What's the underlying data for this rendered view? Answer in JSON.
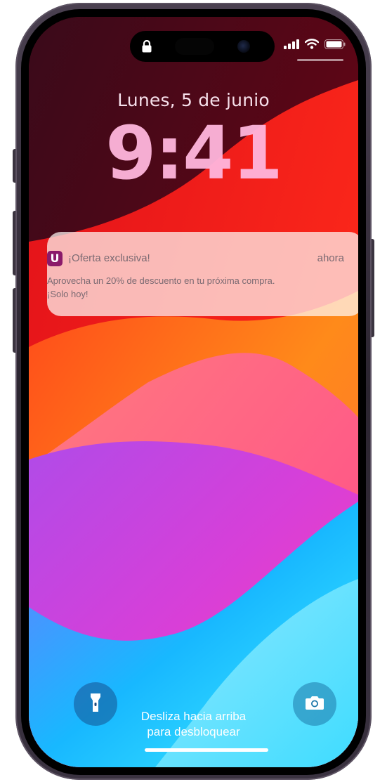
{
  "lockscreen": {
    "date": "Lunes, 5 de junio",
    "time": "9:41",
    "swipe_line1": "Desliza hacia arriba",
    "swipe_line2": "para desbloquear"
  },
  "notification": {
    "app_icon_letter": "U",
    "title": "¡Oferta exclusiva!",
    "time": "ahora",
    "body_line1": "Aprovecha un 20% de descuento en tu próxima compra.",
    "body_line2": "¡Solo hoy!",
    "app_icon_color": "#8b1a6a"
  },
  "status_bar": {
    "icons": [
      "signal-icon",
      "wifi-icon",
      "battery-icon"
    ]
  },
  "controls": {
    "left": "flashlight-icon",
    "right": "camera-icon"
  }
}
